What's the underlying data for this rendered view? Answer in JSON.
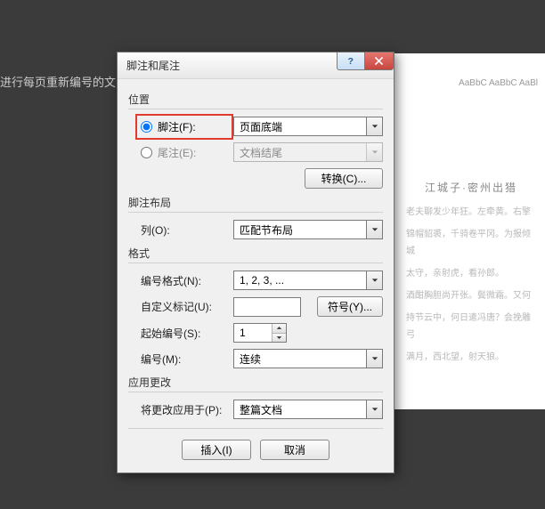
{
  "background": {
    "left_text": "进行每页重新编号的文",
    "ribbon": "AaBbC AaBbC AaBl",
    "doc_title": "江城子·密州出猎",
    "para1": "老夫聊发少年狂。左牵黄。右擎",
    "para2": "锦帽貂裘，千骑卷平冈。为报倾城",
    "para3": "太守，亲射虎，看孙郎。",
    "para4": "酒酣胸胆尚开张。鬓微霜。又何",
    "para5": "持节云中，何日遣冯唐？会挽雕弓",
    "para6": "满月，西北望，射天狼。"
  },
  "dialog": {
    "title": "脚注和尾注",
    "sections": {
      "position": "位置",
      "layout": "脚注布局",
      "format": "格式",
      "apply": "应用更改"
    },
    "position": {
      "footnote_label": "脚注(F):",
      "footnote_value": "页面底端",
      "endnote_label": "尾注(E):",
      "endnote_value": "文档结尾",
      "convert_btn": "转换(C)..."
    },
    "layout": {
      "columns_label": "列(O):",
      "columns_value": "匹配节布局"
    },
    "format": {
      "numfmt_label": "编号格式(N):",
      "numfmt_value": "1, 2, 3, ...",
      "custom_label": "自定义标记(U):",
      "custom_value": "",
      "symbol_btn": "符号(Y)...",
      "start_label": "起始编号(S):",
      "start_value": "1",
      "numbering_label": "编号(M):",
      "numbering_value": "连续"
    },
    "apply": {
      "applyto_label": "将更改应用于(P):",
      "applyto_value": "整篇文档"
    },
    "footer": {
      "insert": "插入(I)",
      "cancel": "取消"
    }
  }
}
